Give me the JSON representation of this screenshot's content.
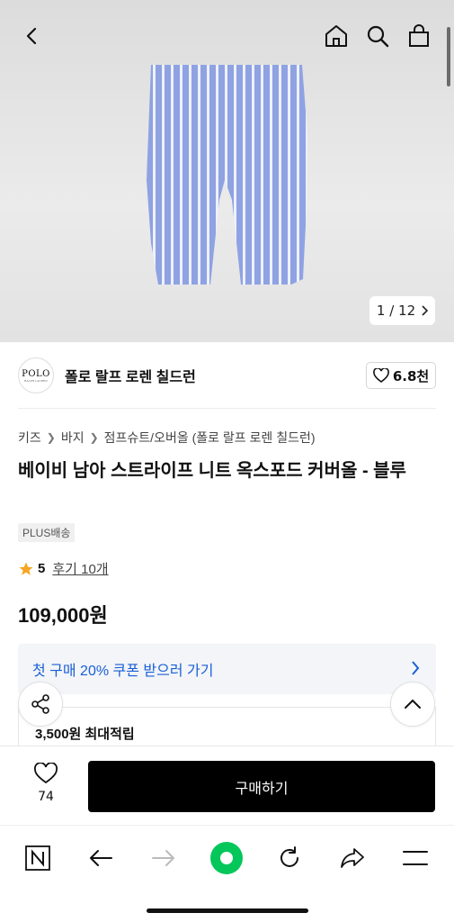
{
  "gallery": {
    "current": "1",
    "separator": "/",
    "total": "12"
  },
  "brand": {
    "logo_text": "POLO",
    "logo_subtext": "RALPH LAUREN",
    "name": "폴로 랄프 로렌 칠드런",
    "likes": "6.8천"
  },
  "breadcrumb": {
    "items": [
      "키즈",
      "바지",
      "점프슈트/오버올 (폴로 랄프 로렌 칠드런)"
    ]
  },
  "product": {
    "title": "베이비 남아 스트라이프 니트 옥스포드 커버올 - 블루",
    "badge": "PLUS배송",
    "rating": "5",
    "reviews": "후기 10개",
    "price": "109,000원"
  },
  "coupon": {
    "label": "첫 구매 20% 쿠폰 받으러 가기"
  },
  "points": {
    "label": "3,500원 최대적립"
  },
  "buybar": {
    "wish_count": "74",
    "buy_label": "구매하기"
  },
  "colors": {
    "accent_blue": "#1a5fd6",
    "star": "#f5a623",
    "green": "#03c75a",
    "stripe_blue": "#8c9fe0"
  },
  "icons": [
    "back-icon",
    "home-icon",
    "search-icon",
    "bag-icon",
    "heart-icon",
    "share-icon",
    "chevron-up-icon",
    "n-icon",
    "arrow-left-icon",
    "arrow-right-icon",
    "green-dot-icon",
    "refresh-icon",
    "forward-share-icon",
    "menu-icon"
  ]
}
